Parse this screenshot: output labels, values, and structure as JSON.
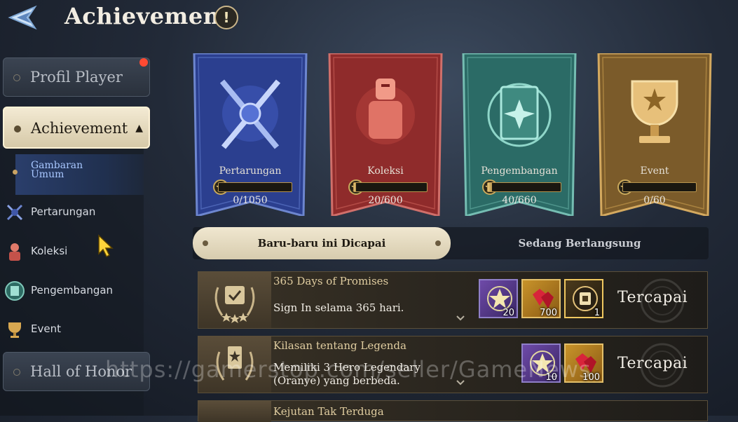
{
  "header": {
    "title": "Achievement",
    "info_label": "!"
  },
  "sidebar": {
    "items": [
      {
        "label": "Profil Player",
        "has_notification": true
      },
      {
        "label": "Achievement",
        "active": true
      },
      {
        "label": "Hall of Honor"
      }
    ],
    "sub_items": [
      {
        "label": "Gambaran Umum",
        "active": true
      },
      {
        "label": "Pertarungan",
        "icon": "crossed-swords-icon"
      },
      {
        "label": "Koleksi",
        "icon": "knight-icon"
      },
      {
        "label": "Pengembangan",
        "icon": "book-icon"
      },
      {
        "label": "Event",
        "icon": "trophy-icon"
      }
    ]
  },
  "categories": [
    {
      "name": "Pertarungan",
      "count": "0/1050",
      "color": "#2a3f8f",
      "icon": "crossed-swords-icon",
      "progress": 0
    },
    {
      "name": "Koleksi",
      "count": "20/600",
      "color": "#8f2a2a",
      "icon": "knight-icon",
      "progress": 0.033
    },
    {
      "name": "Pengembangan",
      "count": "40/660",
      "color": "#2a6a66",
      "icon": "book-icon",
      "progress": 0.061
    },
    {
      "name": "Event",
      "count": "0/60",
      "color": "#7a5a2a",
      "icon": "trophy-icon",
      "progress": 0
    }
  ],
  "tabs": {
    "recent": "Baru-baru ini Dicapai",
    "ongoing": "Sedang Berlangsung"
  },
  "achievements": [
    {
      "title": "365 Days of Promises",
      "desc": "Sign In selama 365 hari.",
      "status": "Tercapai",
      "rewards": [
        {
          "type": "star-medal",
          "qty": "20"
        },
        {
          "type": "ruby",
          "qty": "700"
        },
        {
          "type": "ticket",
          "qty": "1"
        }
      ]
    },
    {
      "title": "Kilasan tentang Legenda",
      "desc": "Memiliki 3 Hero Legendary (Oranye) yang berbeda.",
      "status": "Tercapai",
      "rewards": [
        {
          "type": "star-medal",
          "qty": "10"
        },
        {
          "type": "ruby",
          "qty": "100"
        }
      ]
    },
    {
      "title": "Kejutan Tak Terduga"
    }
  ],
  "watermark": "https://gamerstop.com/seller/GameNews"
}
